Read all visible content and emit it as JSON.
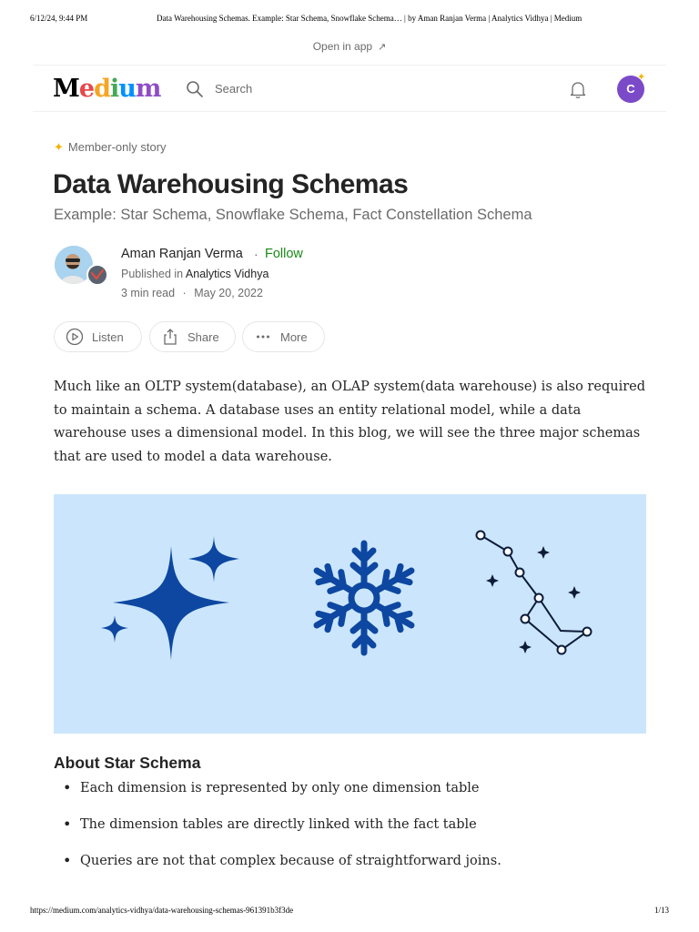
{
  "print_header": {
    "date": "6/12/24, 9:44 PM",
    "title": "Data Warehousing Schemas. Example: Star Schema, Snowflake Schema… | by Aman Ranjan Verma | Analytics Vidhya | Medium"
  },
  "open_in_app": {
    "label": "Open in app",
    "icon": "arrow-up-right-icon"
  },
  "topbar": {
    "logo": "Medium",
    "search_placeholder": "Search",
    "avatar_initial": "C",
    "icons": [
      "search-icon",
      "bell-icon",
      "avatar-icon"
    ]
  },
  "article": {
    "member_badge": "Member-only story",
    "title": "Data Warehousing Schemas",
    "subtitle": "Example: Star Schema, Snowflake Schema, Fact Constellation Schema",
    "author": {
      "name": "Aman Ranjan Verma",
      "separator": "·",
      "follow_label": "Follow",
      "published_prefix": "Published in",
      "publication": "Analytics Vidhya",
      "read_time": "3 min read",
      "meta_separator": "·",
      "date": "May 20, 2022"
    },
    "actions": {
      "listen": "Listen",
      "share": "Share",
      "more": "More"
    },
    "intro": "Much like an OLTP system(database), an OLAP system(data warehouse) is also required to maintain a schema. A database uses an entity relational model, while a data warehouse uses a dimensional model. In this blog, we will see the three major schemas that are used to model a data warehouse.",
    "hero": {
      "background": "#cbe6fc",
      "accent": "#0d47a1",
      "icons": [
        "star-sparkle-icon",
        "snowflake-icon",
        "constellation-icon"
      ]
    },
    "section_heading": "About Star Schema",
    "bullets": [
      "Each dimension is represented by only one dimension table",
      "The dimension tables are directly linked with the fact table",
      "Queries are not that complex because of straightforward joins."
    ]
  },
  "print_footer": {
    "url": "https://medium.com/analytics-vidhya/data-warehousing-schemas-961391b3f3de",
    "page": "1/13"
  },
  "colors": {
    "follow": "#1a8917",
    "avatar": "#7b4ac9",
    "muted": "#6b6b6b",
    "text": "#242424"
  }
}
